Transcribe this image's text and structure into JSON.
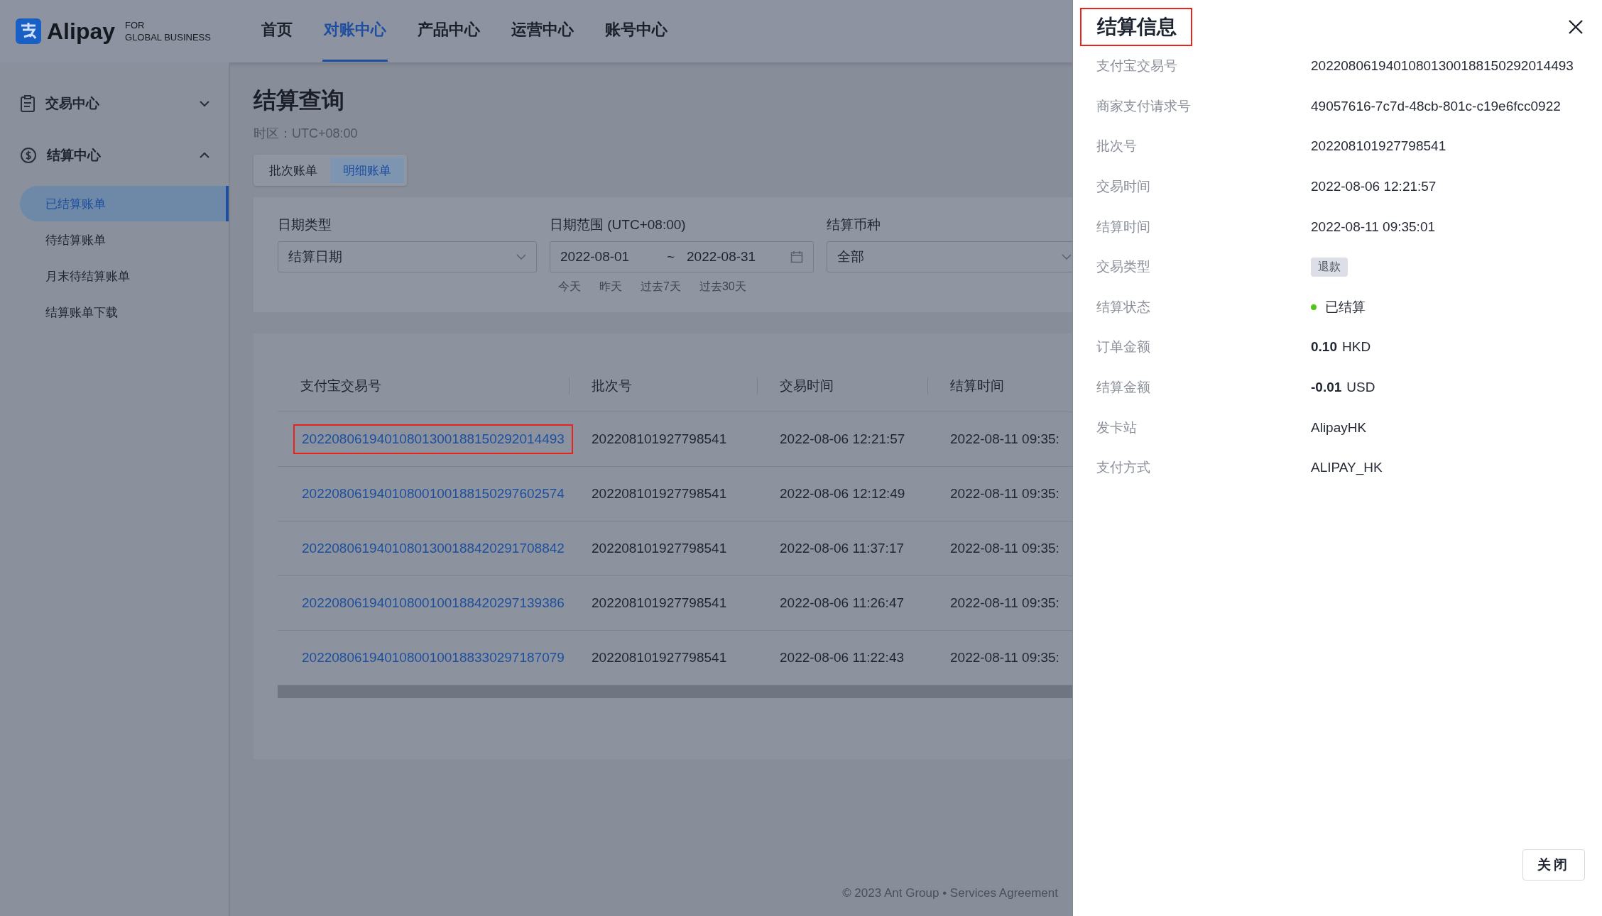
{
  "header": {
    "logo": {
      "brand": "Alipay",
      "tagline_1": "FOR",
      "tagline_2": "GLOBAL BUSINESS"
    },
    "nav": [
      {
        "label": "首页",
        "selected": false
      },
      {
        "label": "对账中心",
        "selected": true
      },
      {
        "label": "产品中心",
        "selected": false
      },
      {
        "label": "运营中心",
        "selected": false
      },
      {
        "label": "账号中心",
        "selected": false
      }
    ]
  },
  "sidebar": {
    "items": [
      {
        "label": "交易中心",
        "kind": "clipboard",
        "expanded": false
      },
      {
        "label": "结算中心",
        "kind": "dollar",
        "expanded": true,
        "children": [
          {
            "label": "已结算账单",
            "selected": true
          },
          {
            "label": "待结算账单",
            "selected": false
          },
          {
            "label": "月末待结算账单",
            "selected": false
          },
          {
            "label": "结算账单下载",
            "selected": false
          }
        ]
      }
    ]
  },
  "page": {
    "title": "结算查询",
    "timezone": "时区：UTC+08:00",
    "tabs": [
      {
        "label": "批次账单",
        "selected": false
      },
      {
        "label": "明细账单",
        "selected": true
      }
    ],
    "filters": {
      "date_type": {
        "label": "日期类型",
        "value": "结算日期"
      },
      "date_range": {
        "label": "日期范围 (UTC+08:00)",
        "start": "2022-08-01",
        "separator": "~",
        "end": "2022-08-31",
        "shortcuts": [
          "今天",
          "昨天",
          "过去7天",
          "过去30天"
        ]
      },
      "currency": {
        "label": "结算币种",
        "value": "全部"
      }
    },
    "table": {
      "columns": [
        "支付宝交易号",
        "批次号",
        "交易时间",
        "结算时间"
      ],
      "rows": [
        {
          "highlighted": true,
          "cells": [
            "20220806194010801300188150292014493",
            "202208101927798541",
            "2022-08-06 12:21:57",
            "2022-08-11 09:35:"
          ]
        },
        {
          "highlighted": false,
          "cells": [
            "20220806194010800100188150297602574",
            "202208101927798541",
            "2022-08-06 12:12:49",
            "2022-08-11 09:35:"
          ]
        },
        {
          "highlighted": false,
          "cells": [
            "20220806194010801300188420291708842",
            "202208101927798541",
            "2022-08-06 11:37:17",
            "2022-08-11 09:35:"
          ]
        },
        {
          "highlighted": false,
          "cells": [
            "20220806194010800100188420297139386",
            "202208101927798541",
            "2022-08-06 11:26:47",
            "2022-08-11 09:35:"
          ]
        },
        {
          "highlighted": false,
          "cells": [
            "20220806194010800100188330297187079",
            "202208101927798541",
            "2022-08-06 11:22:43",
            "2022-08-11 09:35:"
          ]
        }
      ]
    },
    "footer": "© 2023 Ant Group • Services Agreement"
  },
  "drawer": {
    "title": "结算信息",
    "title_highlighted": true,
    "fields": [
      {
        "kind": "text",
        "label": "支付宝交易号",
        "value": "20220806194010801300188150292014493"
      },
      {
        "kind": "text",
        "label": "商家支付请求号",
        "value": "49057616-7c7d-48cb-801c-c19e6fcc0922"
      },
      {
        "kind": "text",
        "label": "批次号",
        "value": "202208101927798541"
      },
      {
        "kind": "text",
        "label": "交易时间",
        "value": "2022-08-06 12:21:57"
      },
      {
        "kind": "text",
        "label": "结算时间",
        "value": "2022-08-11 09:35:01"
      },
      {
        "kind": "tag",
        "label": "交易类型",
        "value": "退款"
      },
      {
        "kind": "status",
        "label": "结算状态",
        "value": "已结算",
        "color": "#52c41a"
      },
      {
        "kind": "amount",
        "label": "订单金额",
        "value": "0.10",
        "currency": "HKD"
      },
      {
        "kind": "amount",
        "label": "结算金额",
        "value": "-0.01",
        "currency": "USD"
      },
      {
        "kind": "text",
        "label": "发卡站",
        "value": "AlipayHK"
      },
      {
        "kind": "text",
        "label": "支付方式",
        "value": "ALIPAY_HK"
      }
    ],
    "close_button": "关闭"
  }
}
